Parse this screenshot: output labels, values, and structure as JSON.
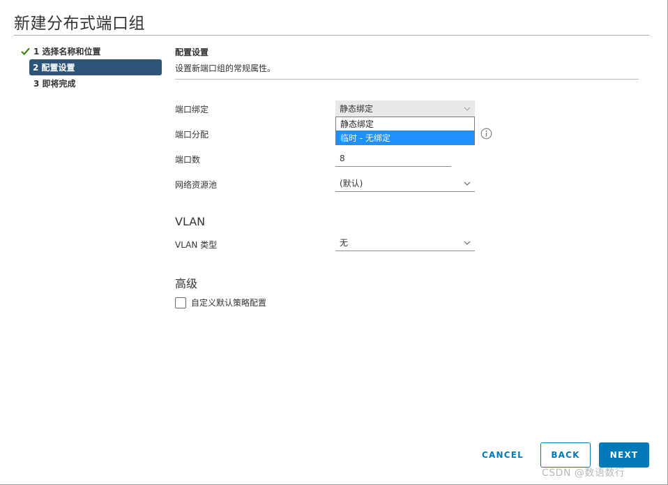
{
  "dialog": {
    "title": "新建分布式端口组"
  },
  "steps": [
    {
      "label": "1 选择名称和位置",
      "status": "complete"
    },
    {
      "label": "2 配置设置",
      "status": "active"
    },
    {
      "label": "3 即将完成",
      "status": "pending"
    }
  ],
  "section": {
    "title": "配置设置",
    "description": "设置新端口组的常规属性。"
  },
  "fields": {
    "port_binding": {
      "label": "端口绑定",
      "value": "静态绑定",
      "options": [
        "静态绑定",
        "临时 - 无绑定"
      ],
      "highlighted": "临时 - 无绑定"
    },
    "port_allocation": {
      "label": "端口分配"
    },
    "port_count": {
      "label": "端口数",
      "value": "8"
    },
    "network_pool": {
      "label": "网络资源池",
      "value": "(默认)"
    }
  },
  "vlan": {
    "heading": "VLAN",
    "type_label": "VLAN 类型",
    "type_value": "无"
  },
  "advanced": {
    "heading": "高级",
    "customize_label": "自定义默认策略配置",
    "customize_checked": false
  },
  "buttons": {
    "cancel": "CANCEL",
    "back": "BACK",
    "next": "NEXT"
  },
  "watermark": "CSDN @数语数行",
  "colors": {
    "accent": "#0079b8",
    "active_step": "#2d557a",
    "check": "#3c8500",
    "dropdown_highlight": "#1e90ff"
  }
}
